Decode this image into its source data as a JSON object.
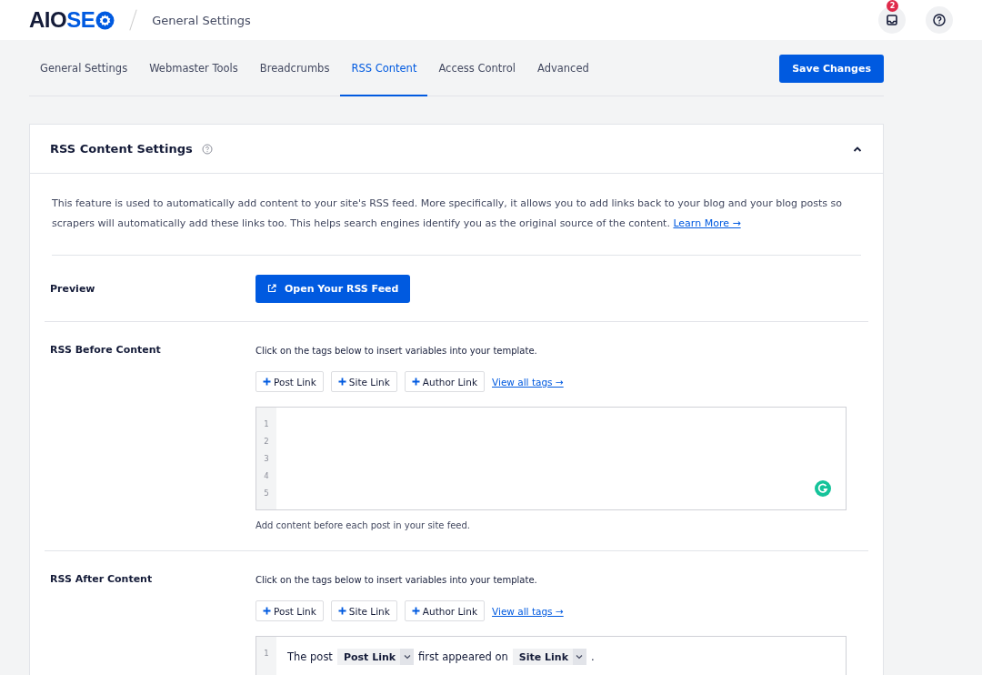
{
  "header": {
    "logo": {
      "dark": "AIO",
      "blue": "SE"
    },
    "breadcrumb": "General Settings",
    "notification_count": "2"
  },
  "tabs": [
    {
      "label": "General Settings",
      "selected": false
    },
    {
      "label": "Webmaster Tools",
      "selected": false
    },
    {
      "label": "Breadcrumbs",
      "selected": false
    },
    {
      "label": "RSS Content",
      "selected": true
    },
    {
      "label": "Access Control",
      "selected": false
    },
    {
      "label": "Advanced",
      "selected": false
    }
  ],
  "save_button": "Save Changes",
  "card": {
    "title": "RSS Content Settings",
    "expanded": true,
    "description": "This feature is used to automatically add content to your site's RSS feed. More specifically, it allows you to add links back to your blog and your blog posts so scrapers will automatically add these links too. This helps search engines identify you as the original source of the content.",
    "learn_more": "Learn More →",
    "preview": {
      "label": "Preview",
      "button": "Open Your RSS Feed"
    },
    "sections": [
      {
        "label": "RSS Before Content",
        "hint": "Click on the tags below to insert variables into your template.",
        "tags": [
          "Post Link",
          "Site Link",
          "Author Link"
        ],
        "view_all": "View all tags →",
        "line_numbers": [
          "1",
          "2",
          "3",
          "4",
          "5"
        ],
        "grammar_badge": true,
        "help": "Add content before each post in your site feed."
      },
      {
        "label": "RSS After Content",
        "hint": "Click on the tags below to insert variables into your template.",
        "tags": [
          "Post Link",
          "Site Link",
          "Author Link"
        ],
        "view_all": "View all tags →",
        "line_numbers": [
          "1"
        ],
        "lines": [
          [
            {
              "kind": "text",
              "text": "The post"
            },
            {
              "kind": "tag",
              "text": "Post Link"
            },
            {
              "kind": "text",
              "text": "first appeared on"
            },
            {
              "kind": "tag",
              "text": "Site Link"
            },
            {
              "kind": "text",
              "text": "."
            }
          ]
        ],
        "grammar_badge": false
      }
    ]
  }
}
